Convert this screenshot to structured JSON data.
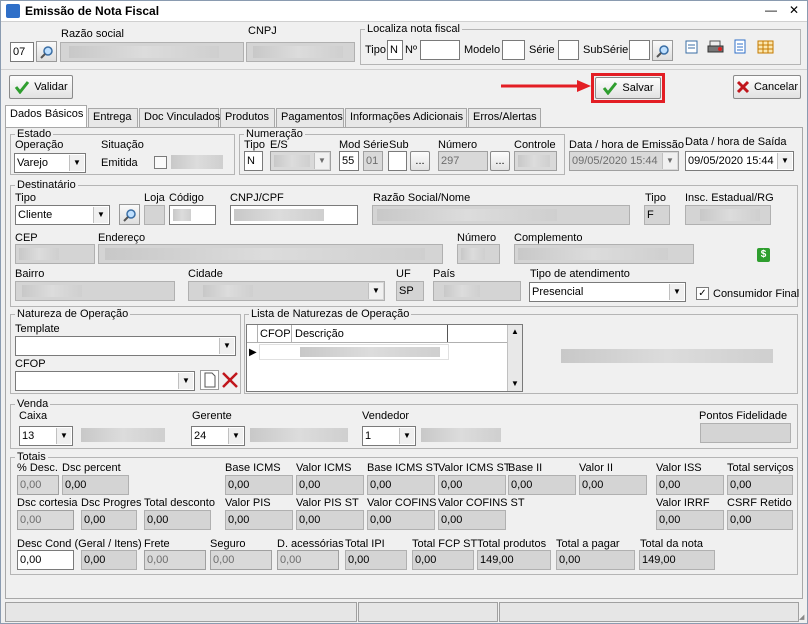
{
  "window": {
    "title": "Emissão de Nota Fiscal",
    "minimize": "—",
    "close": "✕"
  },
  "header": {
    "store_code": "07",
    "razao_social_label": "Razão social",
    "cnpj_label": "CNPJ",
    "localiza": {
      "title": "Localiza nota fiscal",
      "tipo_label": "Tipo",
      "tipo_value": "N",
      "numero_label": "Nº",
      "modelo_label": "Modelo",
      "serie_label": "Série",
      "subserie_label": "SubSérie"
    }
  },
  "toolbar": {
    "validar": "Validar",
    "salvar": "Salvar",
    "cancelar": "Cancelar"
  },
  "tabs": [
    "Dados Básicos",
    "Entrega",
    "Doc Vinculados",
    "Produtos",
    "Pagamentos",
    "Informações Adicionais",
    "Erros/Alertas"
  ],
  "estado": {
    "title": "Estado",
    "operacao_label": "Operação",
    "operacao_value": "Varejo",
    "situacao_label": "Situação",
    "situacao_value": "Emitida"
  },
  "numeracao": {
    "title": "Numeração",
    "tipo_label": "Tipo",
    "tipo_value": "N",
    "es_label": "E/S",
    "mod_label": "Mod",
    "mod_value": "55",
    "serie_label": "Série",
    "serie_value": "01",
    "sub_label": "Sub",
    "numero_label": "Número",
    "numero_value": "297",
    "controle_label": "Controle",
    "ellipsis": "..."
  },
  "datas": {
    "emissao_label": "Data / hora de Emissão",
    "emissao_value": "09/05/2020 15:44",
    "saida_label": "Data / hora de Saída",
    "saida_value": "09/05/2020 15:44"
  },
  "destinatario": {
    "title": "Destinatário",
    "tipo_label": "Tipo",
    "tipo_value": "Cliente",
    "loja_label": "Loja",
    "codigo_label": "Código",
    "cnpj_cpf_label": "CNPJ/CPF",
    "razao_label": "Razão Social/Nome",
    "tipo2_label": "Tipo",
    "tipo2_value": "F",
    "insc_label": "Insc. Estadual/RG",
    "cep_label": "CEP",
    "endereco_label": "Endereço",
    "numero_label": "Número",
    "complemento_label": "Complemento",
    "bairro_label": "Bairro",
    "cidade_label": "Cidade",
    "uf_label": "UF",
    "uf_value": "SP",
    "pais_label": "País",
    "atendimento_label": "Tipo de atendimento",
    "atendimento_value": "Presencial",
    "consumidor_label": "Consumidor Final",
    "consumidor_checked": "✓"
  },
  "natureza": {
    "title": "Natureza de Operação",
    "template_label": "Template",
    "cfop_label": "CFOP"
  },
  "lista_naturezas": {
    "title": "Lista de Naturezas de Operação",
    "col_cfop": "CFOP",
    "col_descricao": "Descrição"
  },
  "venda": {
    "title": "Venda",
    "caixa_label": "Caixa",
    "caixa_value": "13",
    "gerente_label": "Gerente",
    "gerente_value": "24",
    "vendedor_label": "Vendedor",
    "vendedor_value": "1",
    "pontos_label": "Pontos Fidelidade"
  },
  "totais": {
    "title": "Totais",
    "pct_desc_label": "% Desc.",
    "pct_desc_value": "0,00",
    "dsc_percent_label": "Dsc percent",
    "dsc_percent_value": "0,00",
    "base_icms_label": "Base ICMS",
    "base_icms_value": "0,00",
    "valor_icms_label": "Valor ICMS",
    "valor_icms_value": "0,00",
    "base_icms_st_label": "Base ICMS ST",
    "base_icms_st_value": "0,00",
    "valor_icms_st_label": "Valor ICMS ST",
    "valor_icms_st_value": "0,00",
    "base_ii_label": "Base II",
    "base_ii_value": "0,00",
    "valor_ii_label": "Valor II",
    "valor_ii_value": "0,00",
    "valor_iss_label": "Valor ISS",
    "valor_iss_value": "0,00",
    "total_servicos_label": "Total serviços",
    "total_servicos_value": "0,00",
    "dsc_cortesia_label": "Dsc cortesia",
    "dsc_cortesia_value": "0,00",
    "dsc_progres_label": "Dsc Progres",
    "dsc_progres_value": "0,00",
    "total_desconto_label": "Total desconto",
    "total_desconto_value": "0,00",
    "valor_pis_label": "Valor PIS",
    "valor_pis_value": "0,00",
    "valor_pis_st_label": "Valor PIS ST",
    "valor_pis_st_value": "0,00",
    "valor_cofins_label": "Valor COFINS",
    "valor_cofins_value": "0,00",
    "valor_cofins_st_label": "Valor COFINS ST",
    "valor_cofins_st_value": "0,00",
    "valor_irrf_label": "Valor IRRF",
    "valor_irrf_value": "0,00",
    "csrf_label": "CSRF Retido",
    "csrf_value": "0,00",
    "desc_cond_label": "Desc Cond (Geral / Itens)",
    "desc_cond_value1": "0,00",
    "desc_cond_value2": "0,00",
    "frete_label": "Frete",
    "frete_value": "0,00",
    "seguro_label": "Seguro",
    "seguro_value": "0,00",
    "acessorias_label": "D. acessórias",
    "acessorias_value": "0,00",
    "total_ipi_label": "Total IPI",
    "total_ipi_value": "0,00",
    "total_fcp_label": "Total FCP ST",
    "total_fcp_value": "0,00",
    "total_produtos_label": "Total produtos",
    "total_produtos_value": "149,00",
    "total_pagar_label": "Total a pagar",
    "total_pagar_value": "0,00",
    "total_nota_label": "Total da nota",
    "total_nota_value": "149,00"
  },
  "colors": {
    "highlight": "#e31e24",
    "accent_green": "#2f9e2f",
    "cancel_red": "#c0161c"
  }
}
